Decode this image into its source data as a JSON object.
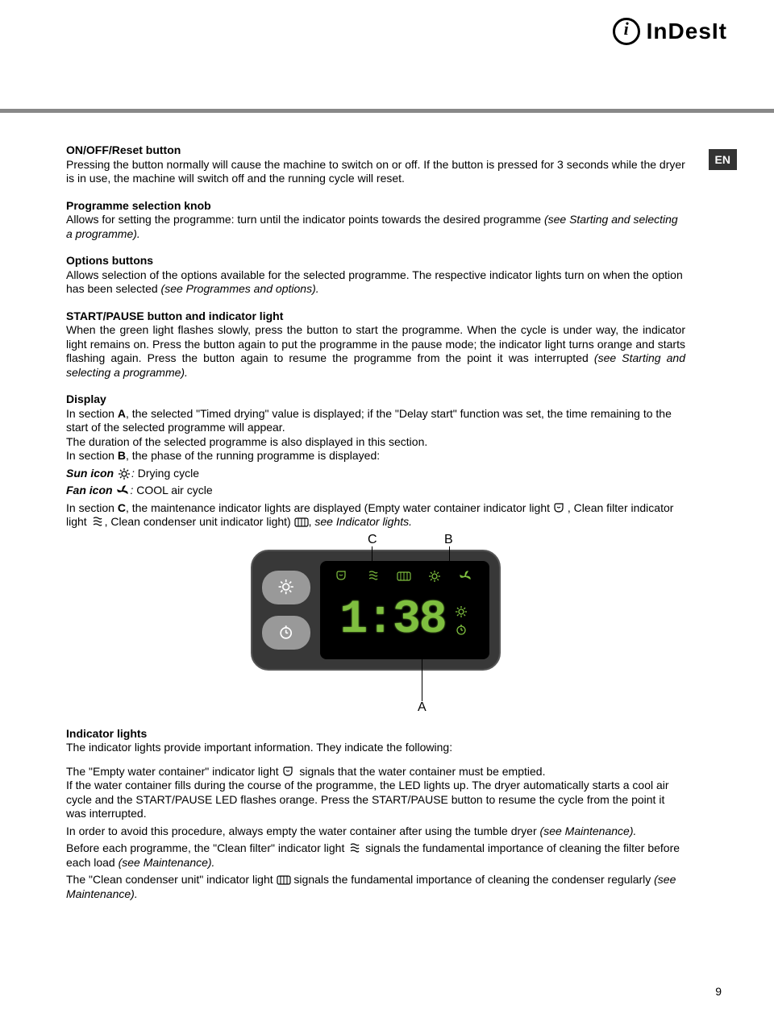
{
  "brand": "InDesIt",
  "lang_badge": "EN",
  "page_number": "9",
  "s1": {
    "heading": "ON/OFF/Reset button",
    "body": "Pressing the button normally will cause the machine to switch on or off. If the button is pressed for 3 seconds while the dryer is in use, the machine will switch off and the running cycle will reset."
  },
  "s2": {
    "heading": "Programme selection knob",
    "body_a": "Allows for setting the programme: turn until the indicator points towards the desired programme ",
    "body_b": "(see Starting and selecting a programme)."
  },
  "s3": {
    "heading": "Options buttons",
    "body_a": "Allows selection of the options available for the selected programme. The respective indicator lights turn on when the option has been selected ",
    "body_b": "(see Programmes and options)."
  },
  "s4": {
    "heading": "START/PAUSE button and indicator light",
    "body_a": "When the green light flashes slowly, press the button to start the programme. When the cycle is under way, the indicator light remains on. Press the button again to put the programme in the pause mode; the indicator light turns orange and starts flashing again. Press the button again to resume the programme from the point it was interrupted ",
    "body_b": "(see Starting and selecting a programme)."
  },
  "s5": {
    "heading": "Display",
    "line1a": "In section ",
    "line1b": "A",
    "line1c": ", the selected \"Timed drying\" value is displayed; if the \"Delay start\" function was set, the time remaining to the start of the selected programme will appear.",
    "line2": "The duration of the selected programme is also displayed in this section.",
    "line3a": "In section ",
    "line3b": "B",
    "line3c": ", the phase of the running programme is displayed:",
    "sun_a": "Sun icon ",
    "sun_b": ": ",
    "sun_c": "Drying cycle",
    "fan_a": "Fan icon ",
    "fan_b": ": ",
    "fan_c": "COOL air cycle",
    "sec_c_a": "In section ",
    "sec_c_b": "C",
    "sec_c_c": ", the maintenance indicator lights are displayed (Empty water container indicator light ",
    "sec_c_d": ", Clean filter indicator light ",
    "sec_c_e": ", Clean condenser unit indicator light) ",
    "sec_c_f": ", ",
    "sec_c_g": "see Indicator lights."
  },
  "figure": {
    "label_c": "C",
    "label_b": "B",
    "label_a": "A",
    "time": "1:38"
  },
  "s6": {
    "heading": "Indicator lights",
    "intro": "The indicator lights provide important information. They indicate the following:",
    "p1a": "The \"Empty water container\" indicator light ",
    "p1b": " signals that the water container must be emptied.",
    "p2": "If the water container fills during the course of the programme, the LED lights up. The dryer automatically starts a cool air cycle and the START/PAUSE LED flashes orange. Press the START/PAUSE button to resume the cycle from the point it was interrupted.",
    "p3a": "In order to avoid this procedure, always empty the water container after using the tumble dryer ",
    "p3b": "(see Maintenance).",
    "p4a": "Before each programme, the \"Clean filter\" indicator light ",
    "p4b": " signals the fundamental importance of cleaning the filter before each load ",
    "p4c": "(see Maintenance).",
    "p5a": "The \"Clean condenser unit\" indicator light ",
    "p5b": " signals the fundamental importance of cleaning the condenser regularly ",
    "p5c": "(see Maintenance)."
  }
}
